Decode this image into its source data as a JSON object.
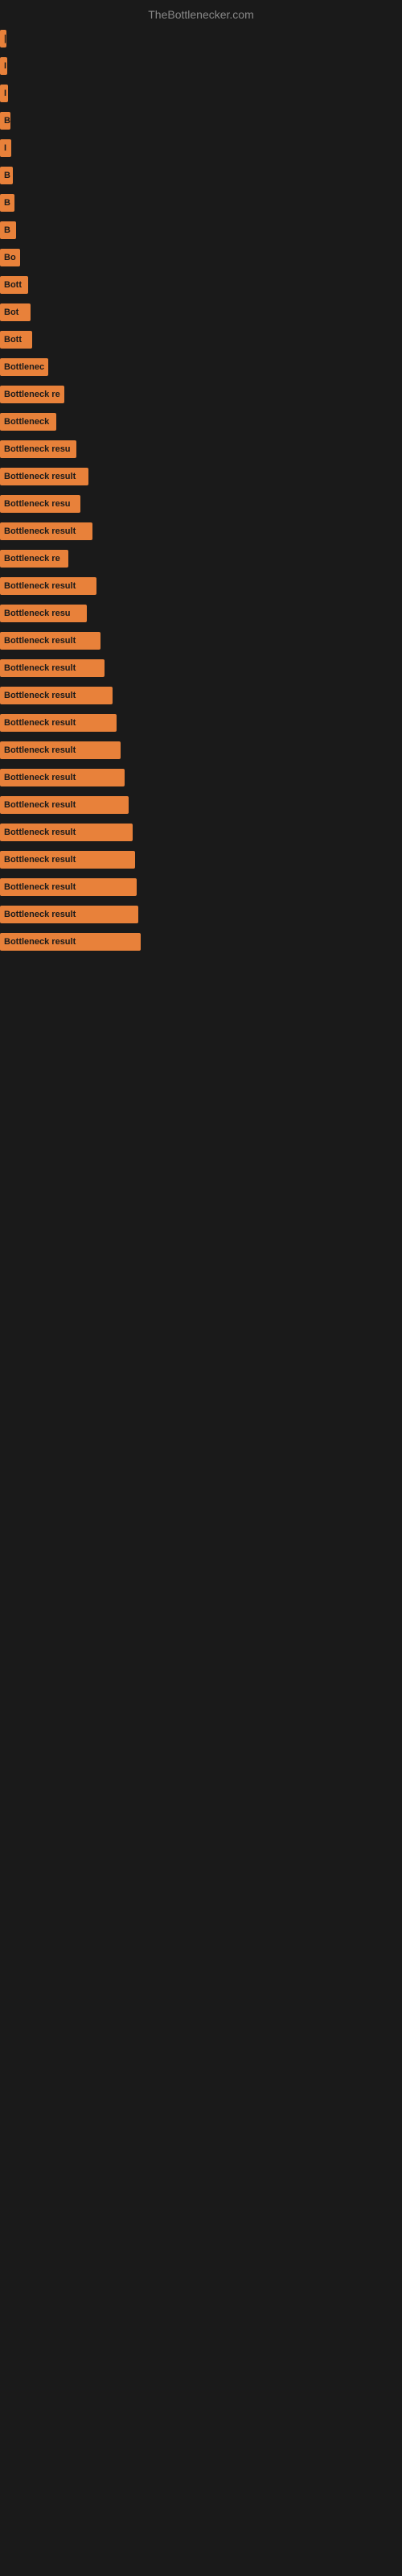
{
  "site_title": "TheBottlenecker.com",
  "bars": [
    {
      "label": "|",
      "width": 8,
      "text": ""
    },
    {
      "label": "I",
      "width": 9,
      "text": ""
    },
    {
      "label": "I",
      "width": 10,
      "text": ""
    },
    {
      "label": "B",
      "width": 13,
      "text": ""
    },
    {
      "label": "I",
      "width": 14,
      "text": ""
    },
    {
      "label": "B",
      "width": 16,
      "text": ""
    },
    {
      "label": "B",
      "width": 18,
      "text": ""
    },
    {
      "label": "B",
      "width": 20,
      "text": ""
    },
    {
      "label": "Bo",
      "width": 25,
      "text": ""
    },
    {
      "label": "Bott",
      "width": 35,
      "text": ""
    },
    {
      "label": "Bot",
      "width": 38,
      "text": ""
    },
    {
      "label": "Bott",
      "width": 40,
      "text": ""
    },
    {
      "label": "Bottlenec",
      "width": 60,
      "text": ""
    },
    {
      "label": "Bottleneck re",
      "width": 80,
      "text": ""
    },
    {
      "label": "Bottleneck",
      "width": 70,
      "text": ""
    },
    {
      "label": "Bottleneck resu",
      "width": 95,
      "text": ""
    },
    {
      "label": "Bottleneck result",
      "width": 110,
      "text": ""
    },
    {
      "label": "Bottleneck resu",
      "width": 100,
      "text": ""
    },
    {
      "label": "Bottleneck result",
      "width": 115,
      "text": ""
    },
    {
      "label": "Bottleneck re",
      "width": 85,
      "text": ""
    },
    {
      "label": "Bottleneck result",
      "width": 120,
      "text": ""
    },
    {
      "label": "Bottleneck resu",
      "width": 108,
      "text": ""
    },
    {
      "label": "Bottleneck result",
      "width": 125,
      "text": ""
    },
    {
      "label": "Bottleneck result",
      "width": 130,
      "text": ""
    },
    {
      "label": "Bottleneck result",
      "width": 140,
      "text": ""
    },
    {
      "label": "Bottleneck result",
      "width": 145,
      "text": ""
    },
    {
      "label": "Bottleneck result",
      "width": 150,
      "text": ""
    },
    {
      "label": "Bottleneck result",
      "width": 155,
      "text": ""
    },
    {
      "label": "Bottleneck result",
      "width": 160,
      "text": ""
    },
    {
      "label": "Bottleneck result",
      "width": 165,
      "text": ""
    },
    {
      "label": "Bottleneck result",
      "width": 168,
      "text": ""
    },
    {
      "label": "Bottleneck result",
      "width": 170,
      "text": ""
    },
    {
      "label": "Bottleneck result",
      "width": 172,
      "text": ""
    },
    {
      "label": "Bottleneck result",
      "width": 175,
      "text": ""
    }
  ]
}
